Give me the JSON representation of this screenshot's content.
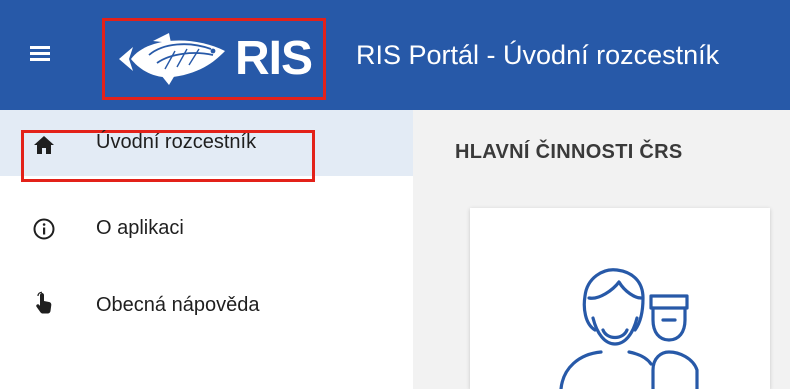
{
  "header": {
    "logo_text": "RIS",
    "title": "RIS Portál - Úvodní rozcestník",
    "menu_icon": "hamburger-menu-icon",
    "logo_icon": "fish-logo-icon"
  },
  "sidebar": {
    "items": [
      {
        "label": "Úvodní rozcestník",
        "icon": "home-icon",
        "active": true
      },
      {
        "label": "O aplikaci",
        "icon": "info-icon",
        "active": false
      },
      {
        "label": "Obecná nápověda",
        "icon": "pointer-hand-icon",
        "active": false
      }
    ]
  },
  "main": {
    "section_title": "HLAVNÍ ČINNOSTI ČRS",
    "card_icon": "fishermen-users-icon"
  },
  "colors": {
    "header_bg": "#2759a8",
    "highlight_border": "#e32119",
    "active_item_bg": "#e3ebf5",
    "content_bg": "#f2f2f2",
    "icon_stroke": "#2759a8"
  }
}
